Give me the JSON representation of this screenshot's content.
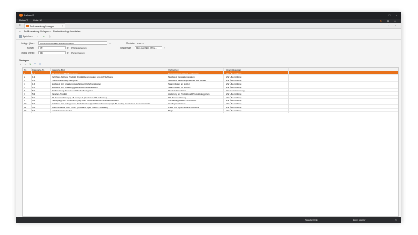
{
  "window": {
    "title": "Bathen21",
    "controls": [
      "minimize-icon",
      "maximize-icon",
      "close-icon"
    ]
  },
  "menubar": {
    "items": [
      "Bathen21",
      "Hinter-IG"
    ]
  },
  "tab": {
    "label": "Profilzuweisung Vorlagen"
  },
  "breadcrumb": {
    "part1": "Profilzuweisung Vorlagen",
    "sep": "►",
    "part2": "Einstandsvorlage bearbeiten"
  },
  "toolbar": {
    "save_label": "Speichern"
  },
  "form": {
    "vorlage_label": "Vorlage (Bez.):",
    "vorlage_value": "KODA Buchvorlage (Weiterbuchung)",
    "kuerzel_label": "Kürzel:",
    "kuerzel_value": "3T1",
    "kuerzel_desc": "Pfeiltaste leeren",
    "erfasst_label": "Erfasst Verlag:",
    "erfasst_value": "140",
    "erfasst_desc": "Person leeren",
    "revise_label": "Revision:",
    "revise_value": "234.1.0",
    "vorlagentyp_label": "Vorlagenart:",
    "vorlagentyp_value": "Klin. geschäftl. PP re..."
  },
  "section": {
    "title": "Vorlagen"
  },
  "grid": {
    "columns": [
      "Nr.",
      "Kategorie-Nr.",
      "Kategorie-Bez.",
      "Verbal-Key",
      "Übermittlungsart"
    ],
    "rows": [
      [
        "1",
        "1.1",
        "PP Vorsteuer/PP Bewertung",
        "Kennzeichnetest (geb. Software)",
        "Zur Übermittlung"
      ],
      [
        "2",
        "1.3",
        "Verfahren Abfrage Produkt, Produktbeteiligkeiten und ggf. Software",
        "Nachweis Verwaltungsdaten",
        "Zur Übermittlung"
      ],
      [
        "3",
        "1.4",
        "Posten-Datenweg Kategorie",
        "Nachweis Fallkonfigurationen aus Verlauf",
        "Zur Übermittlung"
      ],
      [
        "4",
        "1.5",
        "Nachweis zur Erhaltung geschützter Verfahrenskosten",
        "Stammdaten an Nutzer",
        "Zur Übermittlung"
      ],
      [
        "5",
        "1.6",
        "Nachweis zur Erhaltung geschützter Nutzerkosten",
        "Stammdaten zu Nutzern",
        "Zur Übermittlung"
      ],
      [
        "6",
        "5.2",
        "Profilmeldung Produkt und Produktkategorien",
        "Produktdatendaten",
        "Vor zuf Anforderung"
      ],
      [
        "7",
        "5.3",
        "Tabellen-Produkt",
        "Änderung an Produkt und Produktkategorien",
        "Zur Übermittlung"
      ],
      [
        "8",
        "6.1",
        "PP-Kennzeichnung (z. B. Anlage 5 (Zusätzlich PP Software))",
        "PP Kennzeichnung",
        "Zur Übermittlung"
      ],
      [
        "9",
        "6.2",
        "Festlegung des Vorhabens (Ziel) über zu definierenden Softwaremodulen",
        "Verwaltungsdaten PP-Produkt",
        "Zur Übermittlung"
      ],
      [
        "10",
        "6.3",
        "Verfahren zur vorliegenden Produktdaten (Qualitätsanforderungen) z. B. Coding-Guidelines, Codestandards",
        "Coding Guidelines",
        "Zur Übermittlung"
      ],
      [
        "11",
        "6.4",
        "Dokumentation über FOSS (Free and Open Source Software)",
        "Free- und Open-Source-Software",
        "Zur Übermittlung"
      ],
      [
        "12",
        "6.7",
        "Liste bekannter Fehler",
        "Bugs",
        "Zur Übermittlung"
      ]
    ]
  },
  "statusbar": {
    "locale": "Standard DE",
    "user": "Egon Ziegler"
  },
  "colors": {
    "accent": "#e8711a",
    "dark": "#202124"
  }
}
